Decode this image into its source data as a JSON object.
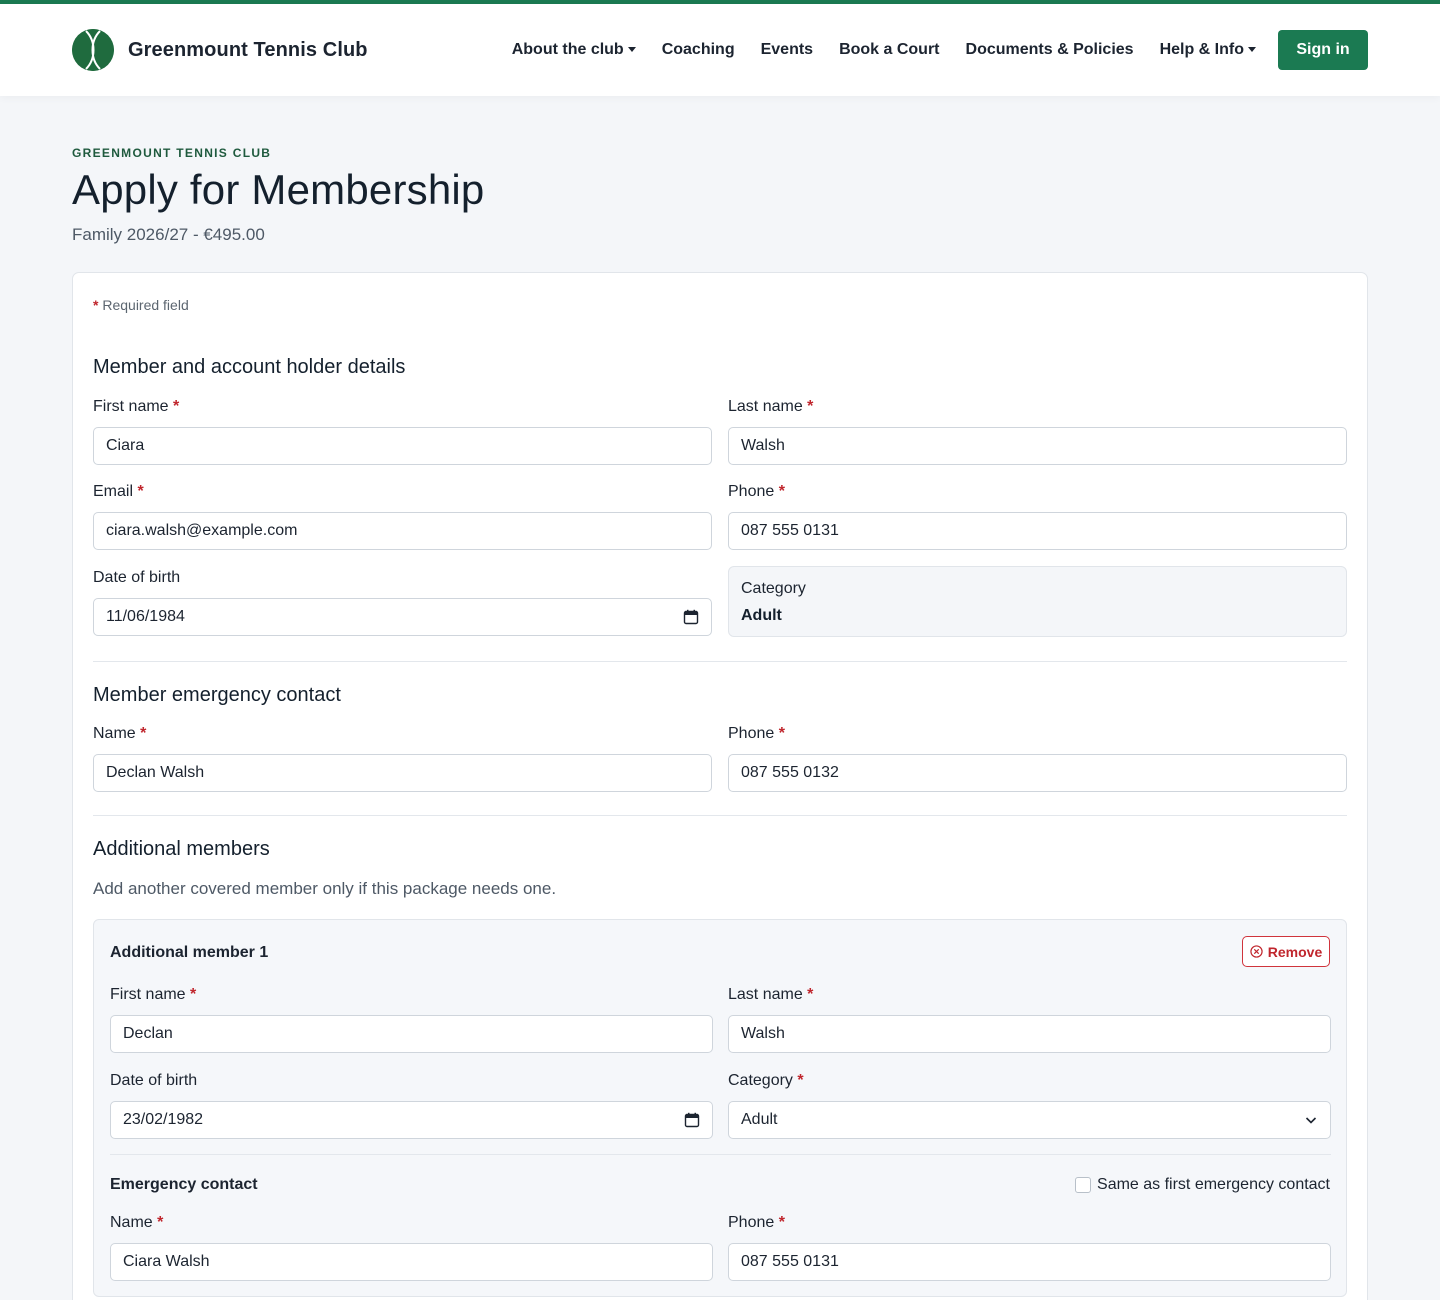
{
  "brand": {
    "name": "Greenmount Tennis Club"
  },
  "nav": {
    "items": [
      {
        "label": "About the club",
        "dropdown": true
      },
      {
        "label": "Coaching",
        "dropdown": false
      },
      {
        "label": "Events",
        "dropdown": false
      },
      {
        "label": "Book a Court",
        "dropdown": false
      },
      {
        "label": "Documents & Policies",
        "dropdown": false
      },
      {
        "label": "Help & Info",
        "dropdown": true
      }
    ],
    "signin": "Sign in"
  },
  "header": {
    "eyebrow": "GREENMOUNT TENNIS CLUB",
    "title": "Apply for Membership",
    "subtitle": "Family 2026/27 - €495.00"
  },
  "form": {
    "required_star": "*",
    "required_note": "Required field",
    "holder": {
      "title": "Member and account holder details",
      "first_name": {
        "label": "First name",
        "value": "Ciara"
      },
      "last_name": {
        "label": "Last name",
        "value": "Walsh"
      },
      "email": {
        "label": "Email",
        "value": "ciara.walsh@example.com"
      },
      "phone": {
        "label": "Phone",
        "value": "087 555 0131"
      },
      "dob": {
        "label": "Date of birth",
        "value": "11/06/1984"
      },
      "category": {
        "label": "Category",
        "value": "Adult"
      }
    },
    "emergency": {
      "title": "Member emergency contact",
      "name": {
        "label": "Name",
        "value": "Declan Walsh"
      },
      "phone": {
        "label": "Phone",
        "value": "087 555 0132"
      }
    },
    "additional": {
      "title": "Additional members",
      "help": "Add another covered member only if this package needs one.",
      "member1": {
        "title": "Additional member 1",
        "remove": "Remove",
        "first_name": {
          "label": "First name",
          "value": "Declan"
        },
        "last_name": {
          "label": "Last name",
          "value": "Walsh"
        },
        "dob": {
          "label": "Date of birth",
          "value": "23/02/1982"
        },
        "category": {
          "label": "Category",
          "value": "Adult"
        },
        "emergency_title": "Emergency contact",
        "same_as": "Same as first emergency contact",
        "ec_name": {
          "label": "Name",
          "value": "Ciara Walsh"
        },
        "ec_phone": {
          "label": "Phone",
          "value": "087 555 0131"
        }
      }
    }
  },
  "colors": {
    "accent": "#1b7a52",
    "danger": "#c0262d",
    "page_bg": "#f4f6f9"
  }
}
